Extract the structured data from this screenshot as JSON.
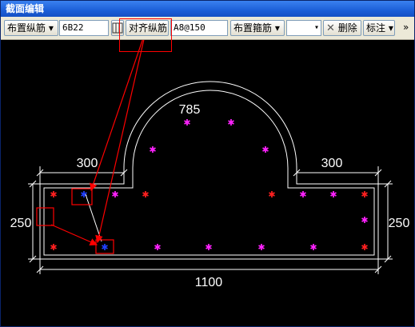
{
  "window": {
    "title": "截面编辑"
  },
  "toolbar": {
    "place_longitudinal": "布置纵筋 ▾",
    "longitudinal_spec": "6B22",
    "align_icon": "grid-icon",
    "align_longitudinal": "对齐纵筋",
    "stirrup_spec": "A8@150",
    "place_stirrup": "布置箍筋 ▾",
    "dropdown_value": "",
    "delete_label": "删除",
    "annotate_label": "标注 ▾",
    "overflow": "»"
  },
  "drawing": {
    "dim_arch": "785",
    "dim_left_top": "300",
    "dim_right_top": "300",
    "dim_left_side": "250",
    "dim_right_side": "250",
    "dim_bottom": "1100"
  },
  "colors": {
    "rebar_red": "#ff2020",
    "rebar_magenta": "#ff22ff",
    "rebar_blue": "#2040ff",
    "annotation_red": "#ff0000",
    "outline": "#ffffff"
  }
}
